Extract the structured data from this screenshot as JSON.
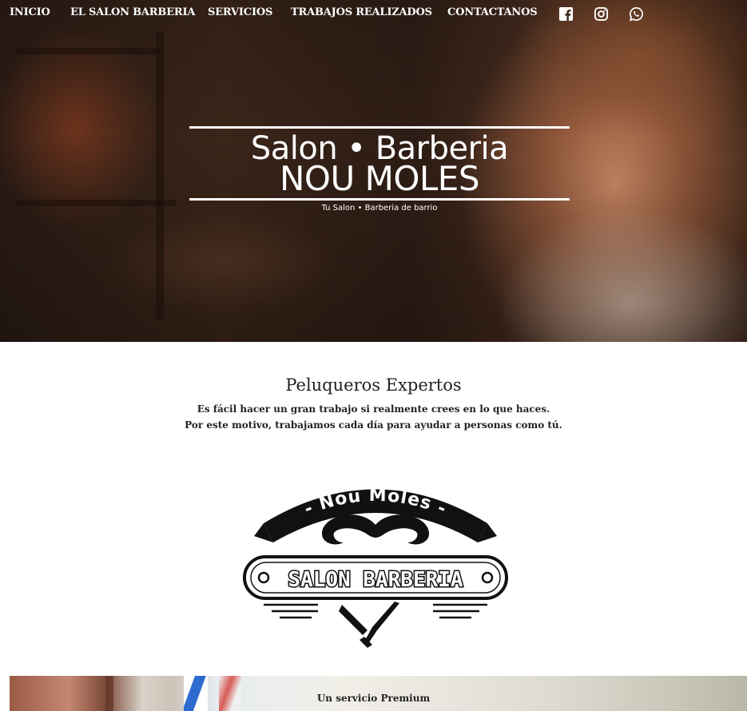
{
  "nav": {
    "items": [
      {
        "label": "INICIO"
      },
      {
        "label": "EL SALON BARBERIA"
      },
      {
        "label": "SERVICIOS"
      },
      {
        "label": "TRABAJOS REALIZADOS"
      },
      {
        "label": "CONTACTANOS"
      }
    ],
    "social": [
      "facebook-icon",
      "instagram-icon",
      "whatsapp-icon"
    ]
  },
  "hero": {
    "title_line1": "Salon • Barberia",
    "title_line2": "NOU MOLES",
    "tagline": "Tu Salon • Barberia de barrio"
  },
  "intro": {
    "title": "Peluqueros Expertos",
    "line1": "Es fácil hacer un gran trabajo si realmente crees en lo que haces.",
    "line2": "Por este motivo, trabajamos cada día para ayudar a personas como tú."
  },
  "logo": {
    "banner_text": "- Nou Moles -",
    "badge_text": "SALON BARBERIA"
  },
  "premium": {
    "heading": "Un servicio Premium"
  },
  "colors": {
    "nav_text": "#ffffff",
    "body_text": "#222222",
    "logo_black": "#111111"
  }
}
